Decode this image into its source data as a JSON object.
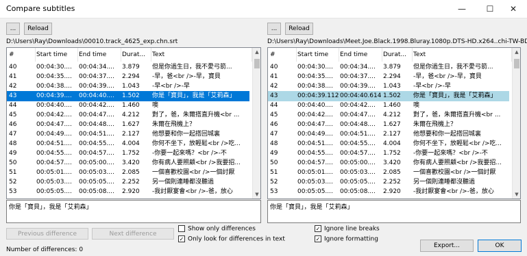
{
  "window": {
    "title": "Compare subtitles",
    "minimize": "—",
    "maximize": "☐",
    "close": "✕"
  },
  "left": {
    "browse_label": "...",
    "reload_label": "Reload",
    "path": "D:\\Users\\Ray\\Downloads\\00010.track_4625_exp.chn.srt",
    "columns": [
      "#",
      "Start time",
      "End time",
      "Durat...",
      "Text"
    ],
    "rows": [
      [
        "40",
        "00:04:30....",
        "00:04:34....",
        "3.879",
        "但是你過生日，我不愛弓箭..."
      ],
      [
        "41",
        "00:04:35....",
        "00:04:37....",
        "2.294",
        "-早，爸<br />-早，寶貝"
      ],
      [
        "42",
        "00:04:38....",
        "00:04:39....",
        "1.043",
        "-早<br />-早"
      ],
      [
        "43",
        "00:04:39....",
        "00:04:40....",
        "1.502",
        "你是「寶貝」，我是「艾莉森」"
      ],
      [
        "44",
        "00:04:40....",
        "00:04:42....",
        "1.460",
        "噢"
      ],
      [
        "45",
        "00:04:42....",
        "00:04:47....",
        "4.212",
        "對了，爸，朱爾搭直升機<br ..."
      ],
      [
        "46",
        "00:04:47....",
        "00:04:48....",
        "1.627",
        "朱爾在飛機上？"
      ],
      [
        "47",
        "00:04:49....",
        "00:04:51....",
        "2.127",
        "他想要和你一起搭回城裏"
      ],
      [
        "48",
        "00:04:51....",
        "00:04:55....",
        "4.004",
        "你何不坐下，放輕鬆<br />吃..."
      ],
      [
        "49",
        "00:04:55....",
        "00:04:57....",
        "1.752",
        "-你要一起來嗎？<br />-不"
      ],
      [
        "50",
        "00:04:57....",
        "00:05:00....",
        "3.420",
        "你有病人要照顧<br />我要招..."
      ],
      [
        "51",
        "00:05:01....",
        "00:05:03....",
        "2.085",
        "一個喜歡校園<br />一個討厭"
      ],
      [
        "52",
        "00:05:03....",
        "00:05:05....",
        "2.252",
        "另一個則連睡都沒聽過"
      ],
      [
        "53",
        "00:05:05....",
        "00:05:08....",
        "2.920",
        "-我討厭宴會<br />-爸，放心"
      ]
    ],
    "selected_text": "你是「寶貝」，我是「艾莉森」"
  },
  "right": {
    "browse_label": "...",
    "reload_label": "Reload",
    "path": "D:\\Users\\Ray\\Downloads\\Meet.Joe.Black.1998.Bluray.1080p.DTS-HD.x264..chi-TW-BD.srt",
    "columns": [
      "#",
      "Start time",
      "End time",
      "Durat...",
      "Text"
    ],
    "rows": [
      [
        "40",
        "00:04:30....",
        "00:04:34....",
        "3.879",
        "但是你過生日，我不愛弓箭..."
      ],
      [
        "41",
        "00:04:35....",
        "00:04:37....",
        "2.294",
        "-早，爸<br />-早，寶貝"
      ],
      [
        "42",
        "00:04:38....",
        "00:04:39....",
        "1.043",
        "-早<br />-早"
      ],
      [
        "43",
        "00:04:39.112",
        "00:04:40.614",
        "1.502",
        "你是「寶貝」，我是「艾莉森」"
      ],
      [
        "44",
        "00:04:40....",
        "00:04:42....",
        "1.460",
        "噢"
      ],
      [
        "45",
        "00:04:42....",
        "00:04:47....",
        "4.212",
        "對了，爸，朱爾搭直升機<br ..."
      ],
      [
        "46",
        "00:04:47....",
        "00:04:48....",
        "1.627",
        "朱爾在飛機上？"
      ],
      [
        "47",
        "00:04:49....",
        "00:04:51....",
        "2.127",
        "他想要和你一起搭回城裏"
      ],
      [
        "48",
        "00:04:51....",
        "00:04:55....",
        "4.004",
        "你何不坐下，放輕鬆<br />吃..."
      ],
      [
        "49",
        "00:04:55....",
        "00:04:57....",
        "1.752",
        "-你要一起來嗎？<br />-不"
      ],
      [
        "50",
        "00:04:57....",
        "00:05:00....",
        "3.420",
        "你有病人要照顧<br />我要招..."
      ],
      [
        "51",
        "00:05:01....",
        "00:05:03....",
        "2.085",
        "一個喜歡校園<br />一個討厭"
      ],
      [
        "52",
        "00:05:03....",
        "00:05:05....",
        "2.252",
        "另一個則連睡都沒聽過"
      ],
      [
        "53",
        "00:05:05....",
        "00:05:08....",
        "2.920",
        "-我討厭宴會<br />-爸，放心"
      ]
    ],
    "selected_text": "你是「寶貝」，我是「艾莉森」"
  },
  "selected_row_index": 3,
  "bottom": {
    "prev_diff": "Previous difference",
    "next_diff": "Next difference",
    "show_only_diff": "Show only differences",
    "only_text_diff": "Only look for differences in text",
    "ignore_line_breaks": "Ignore line breaks",
    "ignore_formatting": "Ignore formatting",
    "export": "Export...",
    "ok": "OK",
    "status": "Number of differences: 0",
    "checks": {
      "show_only_diff": false,
      "only_text_diff": true,
      "ignore_line_breaks": true,
      "ignore_formatting": true
    }
  },
  "colors": {
    "selection_active": "#0078d7",
    "selection_inactive": "#add8e6"
  },
  "icons": {
    "check": "✓",
    "scroll_up": "▲",
    "scroll_down": "▼"
  }
}
